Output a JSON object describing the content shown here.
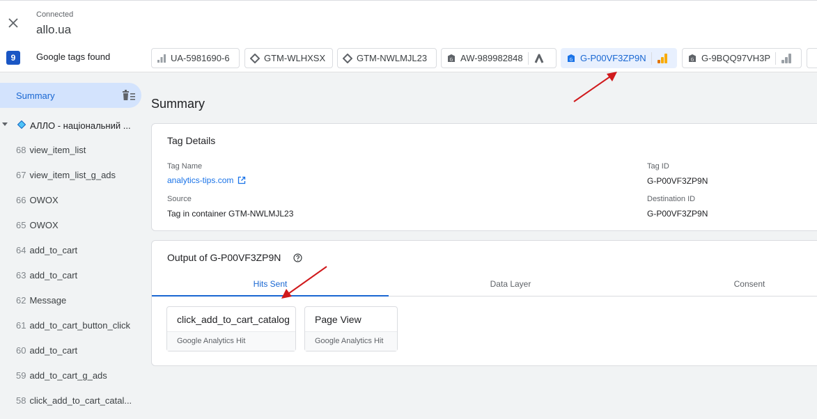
{
  "header": {
    "status": "Connected",
    "site": "allo.ua"
  },
  "tags_bar": {
    "count": "9",
    "label": "Google tags found",
    "chips": [
      {
        "id": "UA-5981690-6",
        "icon": "bar-chart-icon"
      },
      {
        "id": "GTM-WLHXSX",
        "icon": "gtm-diamond-icon"
      },
      {
        "id": "GTM-NWLMJL23",
        "icon": "gtm-diamond-icon"
      },
      {
        "id": "AW-989982848",
        "icon": "google-tag-icon"
      },
      {
        "id": "G-P00VF3ZP9N",
        "icon": "google-tag-icon",
        "active": true
      },
      {
        "id": "G-9BQQ97VH3P",
        "icon": "google-tag-icon"
      }
    ]
  },
  "sidebar": {
    "summary_label": "Summary",
    "container_label": "АЛЛО - національний ...",
    "events": [
      {
        "num": "68",
        "name": "view_item_list"
      },
      {
        "num": "67",
        "name": "view_item_list_g_ads"
      },
      {
        "num": "66",
        "name": "OWOX"
      },
      {
        "num": "65",
        "name": "OWOX"
      },
      {
        "num": "64",
        "name": "add_to_cart"
      },
      {
        "num": "63",
        "name": "add_to_cart"
      },
      {
        "num": "62",
        "name": "Message"
      },
      {
        "num": "61",
        "name": "add_to_cart_button_click"
      },
      {
        "num": "60",
        "name": "add_to_cart"
      },
      {
        "num": "59",
        "name": "add_to_cart_g_ads"
      },
      {
        "num": "58",
        "name": "click_add_to_cart_catal..."
      }
    ]
  },
  "main": {
    "title": "Summary",
    "tag_details": {
      "heading": "Tag Details",
      "tag_name_label": "Tag Name",
      "tag_name_value": "analytics-tips.com",
      "tag_id_label": "Tag ID",
      "tag_id_value": "G-P00VF3ZP9N",
      "source_label": "Source",
      "source_value": "Tag in container GTM-NWLMJL23",
      "destination_label": "Destination ID",
      "destination_value": "G-P00VF3ZP9N"
    },
    "output": {
      "heading": "Output of G-P00VF3ZP9N",
      "tabs": [
        "Hits Sent",
        "Data Layer",
        "Consent"
      ],
      "active_tab": "Hits Sent",
      "hits": [
        {
          "title": "click_add_to_cart_catalog",
          "type": "Google Analytics Hit"
        },
        {
          "title": "Page View",
          "type": "Google Analytics Hit"
        }
      ]
    }
  },
  "colors": {
    "accent": "#1967d2",
    "active_bg": "#d3e3fd",
    "annotation_arrow": "#d0191c",
    "ga_orange": "#f9ab00"
  }
}
